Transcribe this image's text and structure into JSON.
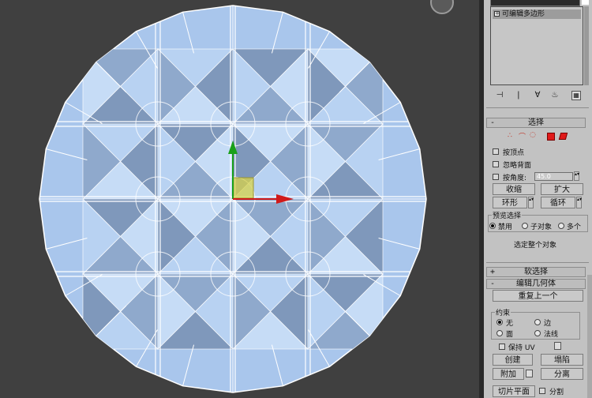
{
  "modifier_stack": {
    "top_field": "",
    "item": "可编辑多边形"
  },
  "stack_toolbar": [
    "pin-stack",
    "show-end-result",
    "make-unique",
    "remove-modifier",
    "configure-modifier-sets"
  ],
  "selection": {
    "title": "选择",
    "header_sign": "-",
    "by_vertex": "按顶点",
    "ignore_backfacing": "忽略背面",
    "by_angle": "按角度:",
    "angle_value": "45.0",
    "shrink": "收缩",
    "grow": "扩大",
    "ring": "环形",
    "loop": "循环",
    "preview_title": "预览选择",
    "preview_off": "禁用",
    "preview_subobj": "子对象",
    "preview_multi": "多个",
    "status": "选定整个对象"
  },
  "soft_selection": {
    "title": "软选择",
    "header_sign": "+"
  },
  "edit_geometry": {
    "title": "编辑几何体",
    "header_sign": "-",
    "repeat_last": "重复上一个",
    "constraints_title": "约束",
    "c_none": "无",
    "c_edge": "边",
    "c_face": "面",
    "c_normal": "法线",
    "preserve_uv": "保持 UV",
    "create": "创建",
    "collapse": "塌陷",
    "attach": "附加",
    "detach": "分离",
    "slice_plane": "切片平面",
    "split": "分割"
  },
  "colors": {
    "viewport_bg": "#404040",
    "mesh_fill": "#a9c6ec",
    "mesh_edge": "#ffffff",
    "panel_bg": "#c2c2c2",
    "gizmo_y": "#1aa01a",
    "gizmo_x": "#d11a1a",
    "gizmo_plane": "#d7d24a"
  }
}
